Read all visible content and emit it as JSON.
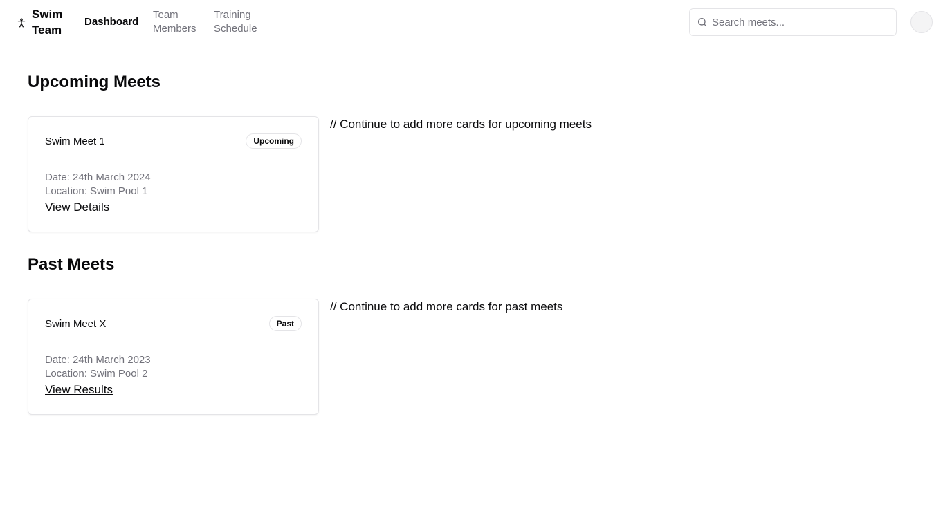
{
  "brand": {
    "name": "Swim Team",
    "icon": "person-accessibility-icon"
  },
  "nav": {
    "dashboard": "Dashboard",
    "team_members": "Team Members",
    "training_schedule": "Training Schedule"
  },
  "search": {
    "placeholder": "Search meets...",
    "value": "",
    "icon": "search-icon"
  },
  "sections": {
    "upcoming": {
      "title": "Upcoming Meets",
      "card": {
        "title": "Swim Meet 1",
        "badge": "Upcoming",
        "date": "Date: 24th March 2024",
        "location": "Location: Swim Pool 1",
        "link": "View Details"
      },
      "comment": "// Continue to add more cards for upcoming meets"
    },
    "past": {
      "title": "Past Meets",
      "card": {
        "title": "Swim Meet X",
        "badge": "Past",
        "date": "Date: 24th March 2023",
        "location": "Location: Swim Pool 2",
        "link": "View Results"
      },
      "comment": "// Continue to add more cards for past meets"
    }
  },
  "colors": {
    "text": "#09090b",
    "muted": "#71717a",
    "border": "#e4e4e7",
    "avatar_bg": "#f4f4f5"
  }
}
